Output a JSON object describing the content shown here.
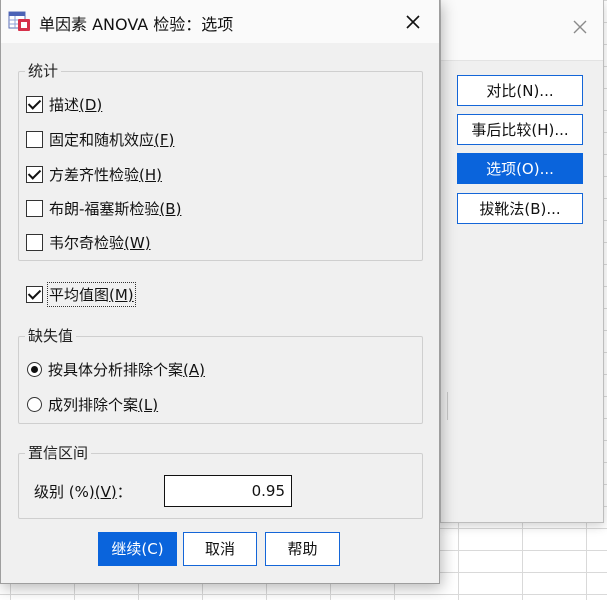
{
  "dialog": {
    "title": "单因素 ANOVA 检验：选项",
    "statistics": {
      "title": "统计",
      "items": [
        {
          "label": "描述",
          "key": "(D)",
          "checked": true
        },
        {
          "label": "固定和随机效应",
          "key": "(F)",
          "checked": false
        },
        {
          "label": "方差齐性检验",
          "key": "(H)",
          "checked": true
        },
        {
          "label": "布朗-福塞斯检验",
          "key": "(B)",
          "checked": false
        },
        {
          "label": "韦尔奇检验",
          "key": "(W)",
          "checked": false
        }
      ]
    },
    "means_plot": {
      "label": "平均值图",
      "key": "(M)",
      "checked": true
    },
    "missing": {
      "title": "缺失值",
      "options": [
        {
          "label": "按具体分析排除个案",
          "key": "(A)",
          "selected": true
        },
        {
          "label": "成列排除个案",
          "key": "(L)",
          "selected": false
        }
      ]
    },
    "confidence": {
      "title": "置信区间",
      "label": "级别 (%)",
      "key": "(V)",
      "suffix": "：",
      "value": "0.95"
    },
    "buttons": {
      "continue": "继续(C)",
      "cancel": "取消",
      "help": "帮助"
    }
  },
  "parent_dialog": {
    "buttons": [
      {
        "label": "对比(N)...",
        "active": false
      },
      {
        "label": "事后比较(H)...",
        "active": false
      },
      {
        "label": "选项(O)...",
        "active": true
      },
      {
        "label": "拔靴法(B)...",
        "active": false
      }
    ]
  },
  "colors": {
    "accent": "#0a64dc",
    "dialog_bg": "#f0f0f0",
    "titlebar_bg": "#fafafa"
  },
  "icons": {
    "app": "spss-app-icon",
    "close": "close-icon"
  }
}
